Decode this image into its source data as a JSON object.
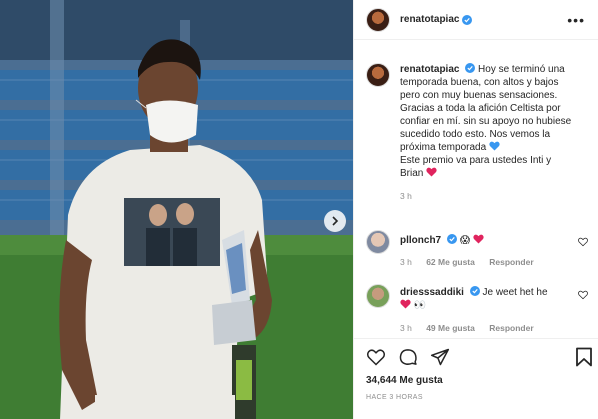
{
  "colors": {
    "verified_blue": "#3897f0",
    "text": "#262626",
    "muted": "#8e8e8e",
    "heart_red": "#e0245e",
    "heart_blue": "#3897f0",
    "pitch_green": "#3f7d33",
    "stadium_blue": "#2f6fa8"
  },
  "header": {
    "username": "renatotapiac"
  },
  "caption": {
    "username": "renatotapiac",
    "lines": [
      "Hoy se terminó una",
      "temporada buena, con altos y bajos",
      "pero con muy buenas sensaciones.",
      "Gracias a toda la afición Celtista por",
      "confiar en mí. sin su apoyo no hubiese",
      "sucedido todo esto. Nos vemos la",
      "próxima temporada",
      "Este premio va para ustedes Inti y",
      "Brian"
    ],
    "time": "3 h"
  },
  "comments": [
    {
      "username": "pllonch7",
      "emoji": "😱",
      "time": "3 h",
      "likes": "62 Me gusta",
      "reply": "Responder"
    },
    {
      "username": "driesssaddiki",
      "text": "Je weet het he",
      "emoji": "👀",
      "time": "3 h",
      "likes": "49 Me gusta",
      "reply": "Responder"
    }
  ],
  "footer": {
    "likes": "34,644 Me gusta",
    "ago": "HACE 3 HORAS"
  },
  "icons": [
    "more-icon",
    "verified-icon",
    "heart-icon",
    "comment-icon",
    "share-icon",
    "save-icon",
    "next-icon"
  ]
}
